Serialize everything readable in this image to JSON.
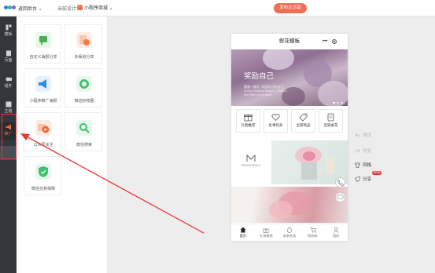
{
  "topbar": {
    "back_label": "返回后台 ⌄",
    "current_design_label": "当前设计:",
    "current_design_value": "小程序商城 ⌄",
    "publish_label": "发布正式版"
  },
  "sidebar": {
    "items": [
      {
        "label": "模板",
        "icon": "template-icon"
      },
      {
        "label": "页面",
        "icon": "page-icon"
      },
      {
        "label": "组件",
        "icon": "component-icon"
      },
      {
        "label": "主题",
        "icon": "theme-icon"
      },
      {
        "label": "推广",
        "icon": "promote-icon"
      }
    ]
  },
  "panel": {
    "cards": [
      {
        "label": "自定义海报分享",
        "color": "#4caf50"
      },
      {
        "label": "多渠道分享",
        "color": "#f57c45"
      },
      {
        "label": "小程序推广海报",
        "color": "#2b8be6"
      },
      {
        "label": "微信好物圈",
        "color": "#46c26a"
      },
      {
        "label": "公众号关注",
        "color": "#f26b3a"
      },
      {
        "label": "微信搜索",
        "color": "#3fbf6a"
      },
      {
        "label": "微信交易保障",
        "color": "#3fbf6a"
      }
    ]
  },
  "phone": {
    "title": "鲜花模板",
    "capsule_dots": "•••",
    "banner": {
      "title": "奖励自己",
      "sub1": "看遍一路花, 奖励努力的自己",
      "sub2": "Every Monday flowers, reward",
      "sub3": "the effort of yourself"
    },
    "nav": [
      {
        "label": "礼物推荐",
        "icon": "gift-icon"
      },
      {
        "label": "生事热卖",
        "icon": "heart-icon"
      },
      {
        "label": "全部商品",
        "icon": "tag-icon"
      },
      {
        "label": "连锁桌花",
        "icon": "note-icon"
      }
    ],
    "brand_name": "DREAM SEOUL",
    "tabs": [
      {
        "label": "首页",
        "icon": "home-icon"
      },
      {
        "label": "礼物推荐",
        "icon": "gift-icon"
      },
      {
        "label": "本季热卖",
        "icon": "fire-icon"
      },
      {
        "label": "购物车",
        "icon": "cart-icon"
      },
      {
        "label": "我的",
        "icon": "user-icon"
      }
    ]
  },
  "actions": {
    "undo": "撤销",
    "redo": "恢复",
    "style": "风格",
    "share": "分享",
    "new_badge": "NEW"
  },
  "colors": {
    "accent": "#f06e55",
    "sidebar_bg": "#33363b",
    "highlight_red": "#e53935"
  }
}
